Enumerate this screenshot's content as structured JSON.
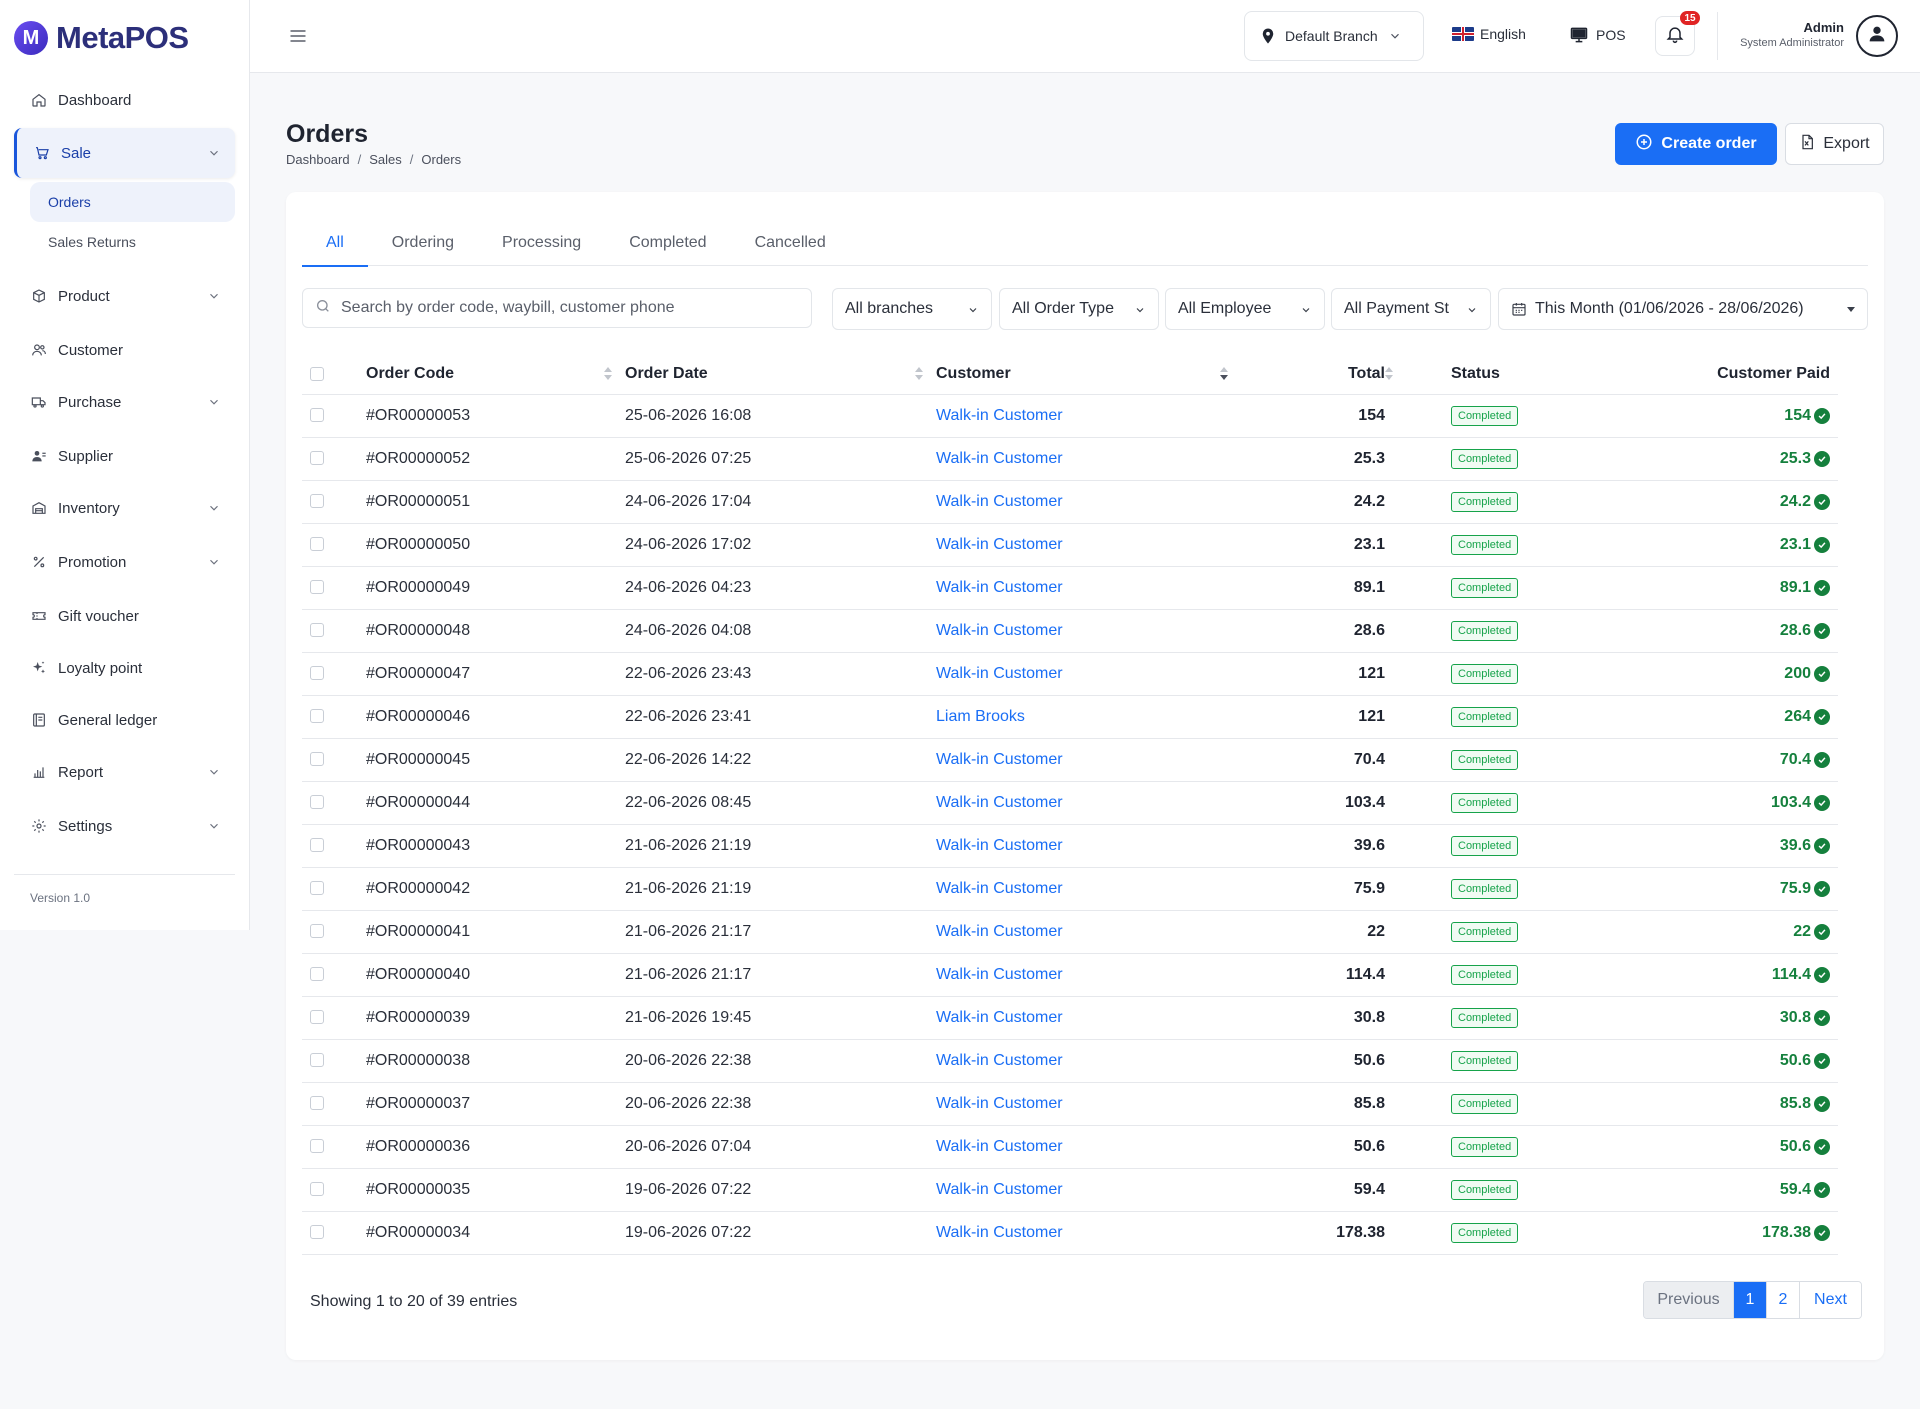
{
  "brand": {
    "logo_letter": "M",
    "name": "MetaPOS"
  },
  "sidebar": {
    "items": [
      {
        "label": "Dashboard",
        "icon": "home-icon",
        "has_chevron": false
      },
      {
        "label": "Sale",
        "icon": "cart-icon",
        "has_chevron": true,
        "active": true
      },
      {
        "label": "Product",
        "icon": "box-icon",
        "has_chevron": true
      },
      {
        "label": "Customer",
        "icon": "users-icon",
        "has_chevron": false
      },
      {
        "label": "Purchase",
        "icon": "truck-icon",
        "has_chevron": true
      },
      {
        "label": "Supplier",
        "icon": "supplier-icon",
        "has_chevron": false
      },
      {
        "label": "Inventory",
        "icon": "warehouse-icon",
        "has_chevron": true
      },
      {
        "label": "Promotion",
        "icon": "percent-icon",
        "has_chevron": true
      },
      {
        "label": "Gift voucher",
        "icon": "ticket-icon",
        "has_chevron": false
      },
      {
        "label": "Loyalty point",
        "icon": "sparkle-icon",
        "has_chevron": false
      },
      {
        "label": "General ledger",
        "icon": "ledger-icon",
        "has_chevron": false
      },
      {
        "label": "Report",
        "icon": "chart-icon",
        "has_chevron": true
      },
      {
        "label": "Settings",
        "icon": "gear-icon",
        "has_chevron": true
      }
    ],
    "sale_sub": [
      "Orders",
      "Sales Returns"
    ],
    "version": "Version 1.0"
  },
  "header": {
    "branch": "Default Branch",
    "language": "English",
    "pos_label": "POS",
    "notification_count": "15",
    "user_name": "Admin",
    "user_role": "System Administrator"
  },
  "page": {
    "title": "Orders",
    "breadcrumb": [
      "Dashboard",
      "Sales",
      "Orders"
    ],
    "create_label": "Create order",
    "export_label": "Export"
  },
  "tabs": [
    "All",
    "Ordering",
    "Processing",
    "Completed",
    "Cancelled"
  ],
  "filters": {
    "search_placeholder": "Search by order code, waybill, customer phone",
    "branches": "All branches",
    "order_type": "All Order Type",
    "employee": "All Employee",
    "payment_status": "All Payment St",
    "date_range": "This Month (01/06/2026 - 28/06/2026)"
  },
  "table": {
    "columns": {
      "code": "Order Code",
      "date": "Order Date",
      "customer": "Customer",
      "total": "Total",
      "status": "Status",
      "paid": "Customer Paid"
    },
    "rows": [
      {
        "code": "#OR00000053",
        "date": "25-06-2026 16:08",
        "customer": "Walk-in Customer",
        "total": "154",
        "status": "Completed",
        "paid": "154"
      },
      {
        "code": "#OR00000052",
        "date": "25-06-2026 07:25",
        "customer": "Walk-in Customer",
        "total": "25.3",
        "status": "Completed",
        "paid": "25.3"
      },
      {
        "code": "#OR00000051",
        "date": "24-06-2026 17:04",
        "customer": "Walk-in Customer",
        "total": "24.2",
        "status": "Completed",
        "paid": "24.2"
      },
      {
        "code": "#OR00000050",
        "date": "24-06-2026 17:02",
        "customer": "Walk-in Customer",
        "total": "23.1",
        "status": "Completed",
        "paid": "23.1"
      },
      {
        "code": "#OR00000049",
        "date": "24-06-2026 04:23",
        "customer": "Walk-in Customer",
        "total": "89.1",
        "status": "Completed",
        "paid": "89.1"
      },
      {
        "code": "#OR00000048",
        "date": "24-06-2026 04:08",
        "customer": "Walk-in Customer",
        "total": "28.6",
        "status": "Completed",
        "paid": "28.6"
      },
      {
        "code": "#OR00000047",
        "date": "22-06-2026 23:43",
        "customer": "Walk-in Customer",
        "total": "121",
        "status": "Completed",
        "paid": "200"
      },
      {
        "code": "#OR00000046",
        "date": "22-06-2026 23:41",
        "customer": "Liam Brooks",
        "total": "121",
        "status": "Completed",
        "paid": "264"
      },
      {
        "code": "#OR00000045",
        "date": "22-06-2026 14:22",
        "customer": "Walk-in Customer",
        "total": "70.4",
        "status": "Completed",
        "paid": "70.4"
      },
      {
        "code": "#OR00000044",
        "date": "22-06-2026 08:45",
        "customer": "Walk-in Customer",
        "total": "103.4",
        "status": "Completed",
        "paid": "103.4"
      },
      {
        "code": "#OR00000043",
        "date": "21-06-2026 21:19",
        "customer": "Walk-in Customer",
        "total": "39.6",
        "status": "Completed",
        "paid": "39.6"
      },
      {
        "code": "#OR00000042",
        "date": "21-06-2026 21:19",
        "customer": "Walk-in Customer",
        "total": "75.9",
        "status": "Completed",
        "paid": "75.9"
      },
      {
        "code": "#OR00000041",
        "date": "21-06-2026 21:17",
        "customer": "Walk-in Customer",
        "total": "22",
        "status": "Completed",
        "paid": "22"
      },
      {
        "code": "#OR00000040",
        "date": "21-06-2026 21:17",
        "customer": "Walk-in Customer",
        "total": "114.4",
        "status": "Completed",
        "paid": "114.4"
      },
      {
        "code": "#OR00000039",
        "date": "21-06-2026 19:45",
        "customer": "Walk-in Customer",
        "total": "30.8",
        "status": "Completed",
        "paid": "30.8"
      },
      {
        "code": "#OR00000038",
        "date": "20-06-2026 22:38",
        "customer": "Walk-in Customer",
        "total": "50.6",
        "status": "Completed",
        "paid": "50.6"
      },
      {
        "code": "#OR00000037",
        "date": "20-06-2026 22:38",
        "customer": "Walk-in Customer",
        "total": "85.8",
        "status": "Completed",
        "paid": "85.8"
      },
      {
        "code": "#OR00000036",
        "date": "20-06-2026 07:04",
        "customer": "Walk-in Customer",
        "total": "50.6",
        "status": "Completed",
        "paid": "50.6"
      },
      {
        "code": "#OR00000035",
        "date": "19-06-2026 07:22",
        "customer": "Walk-in Customer",
        "total": "59.4",
        "status": "Completed",
        "paid": "59.4"
      },
      {
        "code": "#OR00000034",
        "date": "19-06-2026 07:22",
        "customer": "Walk-in Customer",
        "total": "178.38",
        "status": "Completed",
        "paid": "178.38"
      }
    ]
  },
  "footer": {
    "entries_text": "Showing 1 to 20 of 39 entries",
    "previous": "Previous",
    "pages": [
      "1",
      "2"
    ],
    "next": "Next"
  },
  "colors": {
    "primary": "#1a6ef5",
    "success": "#15803d",
    "brand": "#2c2f7a",
    "badge": "#e02424"
  }
}
